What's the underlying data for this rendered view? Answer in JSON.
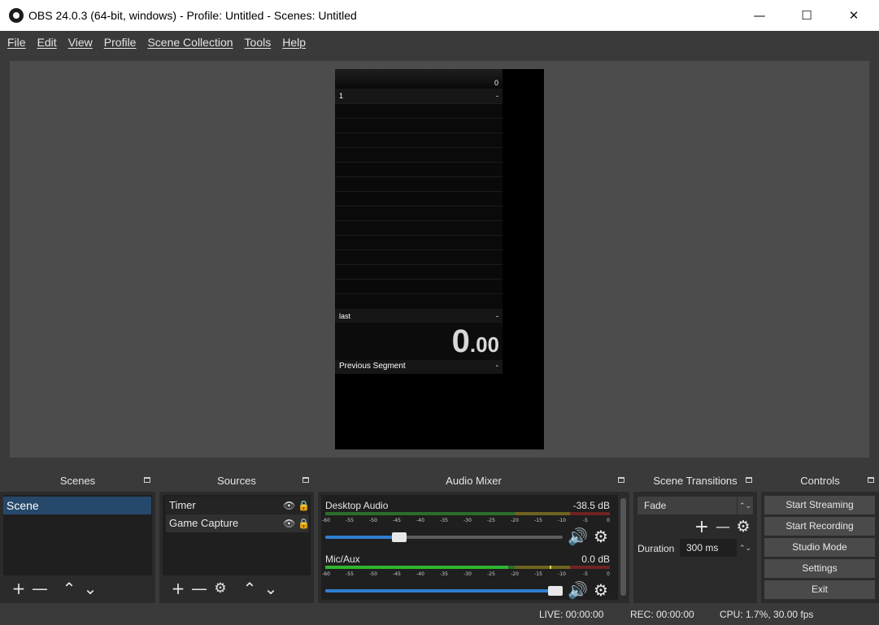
{
  "window": {
    "title": "OBS 24.0.3 (64-bit, windows) - Profile: Untitled - Scenes: Untitled",
    "minimize": "—",
    "maximize": "☐",
    "close": "✕"
  },
  "menu": [
    "File",
    "Edit",
    "View",
    "Profile",
    "Scene Collection",
    "Tools",
    "Help"
  ],
  "preview": {
    "splits_header_value": "0",
    "split_1_name": "1",
    "split_1_time": "-",
    "last_label": "last",
    "last_value": "-",
    "timer_main": "0",
    "timer_decimal": ".00",
    "previous_segment_label": "Previous Segment",
    "previous_segment_value": "-"
  },
  "scenes": {
    "title": "Scenes",
    "items": [
      "Scene"
    ]
  },
  "sources": {
    "title": "Sources",
    "items": [
      "Timer",
      "Game Capture"
    ]
  },
  "audio_mixer": {
    "title": "Audio Mixer",
    "channels": [
      {
        "name": "Desktop Audio",
        "db": "-38.5 dB",
        "volume": 0.3
      },
      {
        "name": "Mic/Aux",
        "db": "0.0 dB",
        "volume": 1.0
      }
    ],
    "scale": [
      "-60",
      "-55",
      "-50",
      "-45",
      "-40",
      "-35",
      "-30",
      "-25",
      "-20",
      "-15",
      "-10",
      "-5",
      "0"
    ]
  },
  "scene_transitions": {
    "title": "Scene Transitions",
    "selected": "Fade",
    "duration_label": "Duration",
    "duration_value": "300 ms"
  },
  "controls": {
    "title": "Controls",
    "start_streaming": "Start Streaming",
    "start_recording": "Start Recording",
    "studio_mode": "Studio Mode",
    "settings": "Settings",
    "exit": "Exit"
  },
  "status": {
    "live": "LIVE: 00:00:00",
    "rec": "REC: 00:00:00",
    "cpu": "CPU: 1.7%, 30.00 fps"
  },
  "colors": {
    "selection": "#26486a",
    "meter_green": "#2fb52f",
    "meter_yellow": "#c8b42a",
    "meter_red": "#c83232",
    "fader_blue": "#2f7fd0"
  }
}
